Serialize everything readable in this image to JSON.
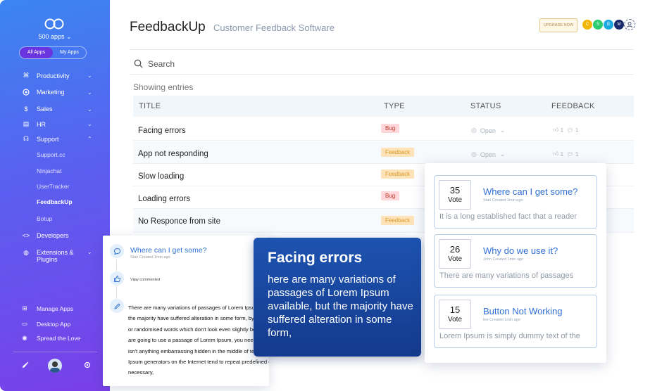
{
  "sidebar": {
    "apps_count": "500 apps",
    "toggle": {
      "all": "All Apps",
      "mine": "My Apps"
    },
    "nav": [
      {
        "label": "Productivity",
        "icon": "command-icon",
        "expandable": true
      },
      {
        "label": "Marketing",
        "icon": "target-icon",
        "expandable": true
      },
      {
        "label": "Sales",
        "icon": "dollar-icon",
        "expandable": true
      },
      {
        "label": "HR",
        "icon": "hr-icon",
        "expandable": true
      },
      {
        "label": "Support",
        "icon": "headset-icon",
        "expanded": true
      }
    ],
    "support_items": [
      "Support.cc",
      "Ninjachat",
      "UserTracker",
      "FeedbackUp",
      "Botup"
    ],
    "active_item": "FeedbackUp",
    "nav2": [
      {
        "label": "Developers",
        "icon": "code-icon"
      },
      {
        "label": "Extensions &",
        "label2": "Plugins",
        "icon": "extensions-icon"
      }
    ],
    "bottom": [
      {
        "label": "Manage Apps",
        "icon": "grid-icon"
      },
      {
        "label": "Desktop App",
        "icon": "monitor-icon"
      },
      {
        "label": "Spread the Love",
        "icon": "share-icon"
      }
    ]
  },
  "header": {
    "title": "FeedbackUp",
    "subtitle": "Customer Feedback Software",
    "upgrade": "UPGRADE NOW",
    "avatars": [
      {
        "initial": "C",
        "color": "#f2b705"
      },
      {
        "initial": "S",
        "color": "#2ecc71"
      },
      {
        "initial": "B",
        "color": "#1ea8e0"
      },
      {
        "initial": "M",
        "color": "#1a2a6c"
      }
    ]
  },
  "search": {
    "placeholder": "Search"
  },
  "table": {
    "showing": "Showing entries",
    "columns": [
      "TITLE",
      "TYPE",
      "STATUS",
      "FEEDBACK"
    ],
    "rows": [
      {
        "title": "Facing errors",
        "type": "Bug",
        "status": "Open",
        "likes": "1",
        "comments": "1"
      },
      {
        "title": "App not responding",
        "type": "Feedback",
        "status": "Open",
        "likes": "1",
        "comments": "1"
      },
      {
        "title": "Slow loading",
        "type": "Feedback"
      },
      {
        "title": "Loading errors",
        "type": "Bug"
      },
      {
        "title": "No Responce from site",
        "type": "Feedback"
      }
    ]
  },
  "comment_card": {
    "question": "Where can I get some?",
    "meta": "Stan Created 1min ago",
    "voted": "Vijay commented",
    "text": "There are many variations of passages of Lorem Ipsum available, but the majority have suffered alteration in some form, by injected humour, or randomised words which don't look even slightly believable. If you are going to use a passage of Lorem Ipsum, you need to be sure there isn't anything embarrassing hidden in the middle of text.All the Lorem Ipsum generators on the Internet tend to repeat predefined chunks as necessary,"
  },
  "popup": {
    "title": "Facing errors",
    "body": "here are many variations of passages of Lorem Ipsum available, but the majority have suffered alteration in some form,"
  },
  "votes": [
    {
      "count": "35",
      "label": "Vote",
      "question": "Where can I get some?",
      "meta": "Stan Created 1min ago",
      "text": "It is a long established fact that a reader"
    },
    {
      "count": "26",
      "label": "Vote",
      "question": "Why do we use it?",
      "meta": "John Created 1min ago",
      "text": "There are many variations of passages"
    },
    {
      "count": "15",
      "label": "Vote",
      "question": "Button Not Working",
      "meta": "tee Created 1min ago",
      "text": "Lorem Ipsum is simply dummy text of the"
    }
  ]
}
